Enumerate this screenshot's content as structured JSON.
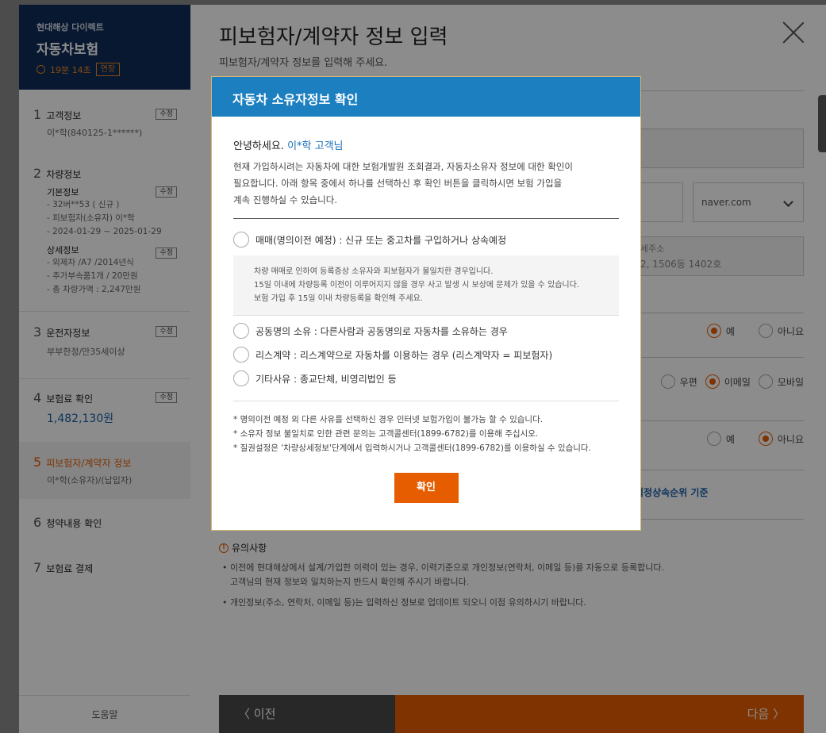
{
  "sidebar": {
    "brand_sub": "현대해상 다이렉트",
    "brand_title": "자동차보험",
    "timer": "19분 14초",
    "extend_label": "연장",
    "edit_label": "수정",
    "steps": [
      {
        "num": "1",
        "title": "고객정보",
        "sub": "이*학(840125-1******)"
      },
      {
        "num": "2",
        "title": "차량정보",
        "basic_head": "기본정보",
        "basic_lines": [
          "- 32버**53 ( 신규 )",
          "- 피보험자(소유자) 이*학",
          "- 2024-01-29 ~ 2025-01-29"
        ],
        "detail_head": "상세정보",
        "detail_lines": [
          "- 외제차 /A7 /2014년식",
          "- 추가부속품1개 / 20만원",
          "- 총 차량가액 : 2,247만원"
        ]
      },
      {
        "num": "3",
        "title": "운전자정보",
        "sub": "부부한정/만35세이상"
      },
      {
        "num": "4",
        "title": "보험료 확인",
        "price": "1,482,130원"
      },
      {
        "num": "5",
        "title": "피보험자/계약자 정보",
        "sub": "이*학(소유자)/(납입자)"
      },
      {
        "num": "6",
        "title": "청약내용 확인"
      },
      {
        "num": "7",
        "title": "보험료 결제"
      }
    ],
    "help_label": "도움말"
  },
  "main": {
    "title": "피보험자/계약자 정보 입력",
    "subtitle": "피보험자/계약자 정보를 입력해 주세요.",
    "email_domain": "naver.com",
    "address_label": "세주소",
    "address_value": "2, 1506동 1402호",
    "radio_yes": "예",
    "radio_no": "아니요",
    "radio_post": "우편",
    "radio_email": "이메일",
    "radio_mobile": "모바일",
    "inheritance_text": "법정상속순위 기준",
    "notice_title": "유의사항",
    "notice_1a": "• 이전에 현대해상에서 설계/가입한 이력이 있는 경우, 이력기준으로 개인정보(연락처, 이메일 등)를 자동으로 등록합니다.",
    "notice_1b": "고객님의 현재 정보와 일치하는지 반드시 확인해 주시기 바랍니다.",
    "notice_2": "• 개인정보(주소, 연락처, 이메일 등)는 입력하신 정보로 업데이트 되오니 이점 유의하시기 바랍니다.",
    "prev_label": "〈  이전",
    "next_label": "다음  〉"
  },
  "modal": {
    "title": "자동차 소유자정보 확인",
    "greeting": "안녕하세요.",
    "customer": "이*학 고객님",
    "intro_1": "현재 가입하시려는 자동차에 대한 보험개발원 조회결과, 자동차소유자 정보에 대한 확인이",
    "intro_2": "필요합니다. 아래 항목 중에서 하나를 선택하신 후 확인 버튼을 클릭하시면 보험 가입을",
    "intro_3": "계속 진행하실 수 있습니다.",
    "options": [
      "매매(명의이전 예정) : 신규 또는 중고차를 구입하거나 상속예정",
      "공동명의 소유 : 다른사람과 공동명의로 자동차를 소유하는 경우",
      "리스계약 : 리스계약으로 자동차를 이용하는 경우 (리스계약자 = 피보험자)",
      "기타사유 : 종교단체, 비영리법인 등"
    ],
    "info_1": "차량 매매로 인하여 등록증상 소유자와 피보험자가 불일치한 경우입니다.",
    "info_2": "15일 이내에 차량등록 이전이 이루어지지 않을 경우 사고 발생 시 보상에 문제가 있을 수 있습니다.",
    "info_3": "보험 가입 후 15일 이내 차량등록을 확인해 주세요.",
    "note_1": "* 명의이전 예정 외 다른 사유를 선택하신 경우 인터넷 보험가입이 불가능 할 수 있습니다.",
    "note_2": "* 소유자 정보 불일치로 인한 관련 문의는 고객콜센터(1899-6782)를 이용해 주십시오.",
    "note_3": "* 질권설정은 '차량상세정보'단계에서 입력하시거나 고객콜센터(1899-6782)를 이용하실 수 있습니다.",
    "confirm_label": "확인"
  }
}
